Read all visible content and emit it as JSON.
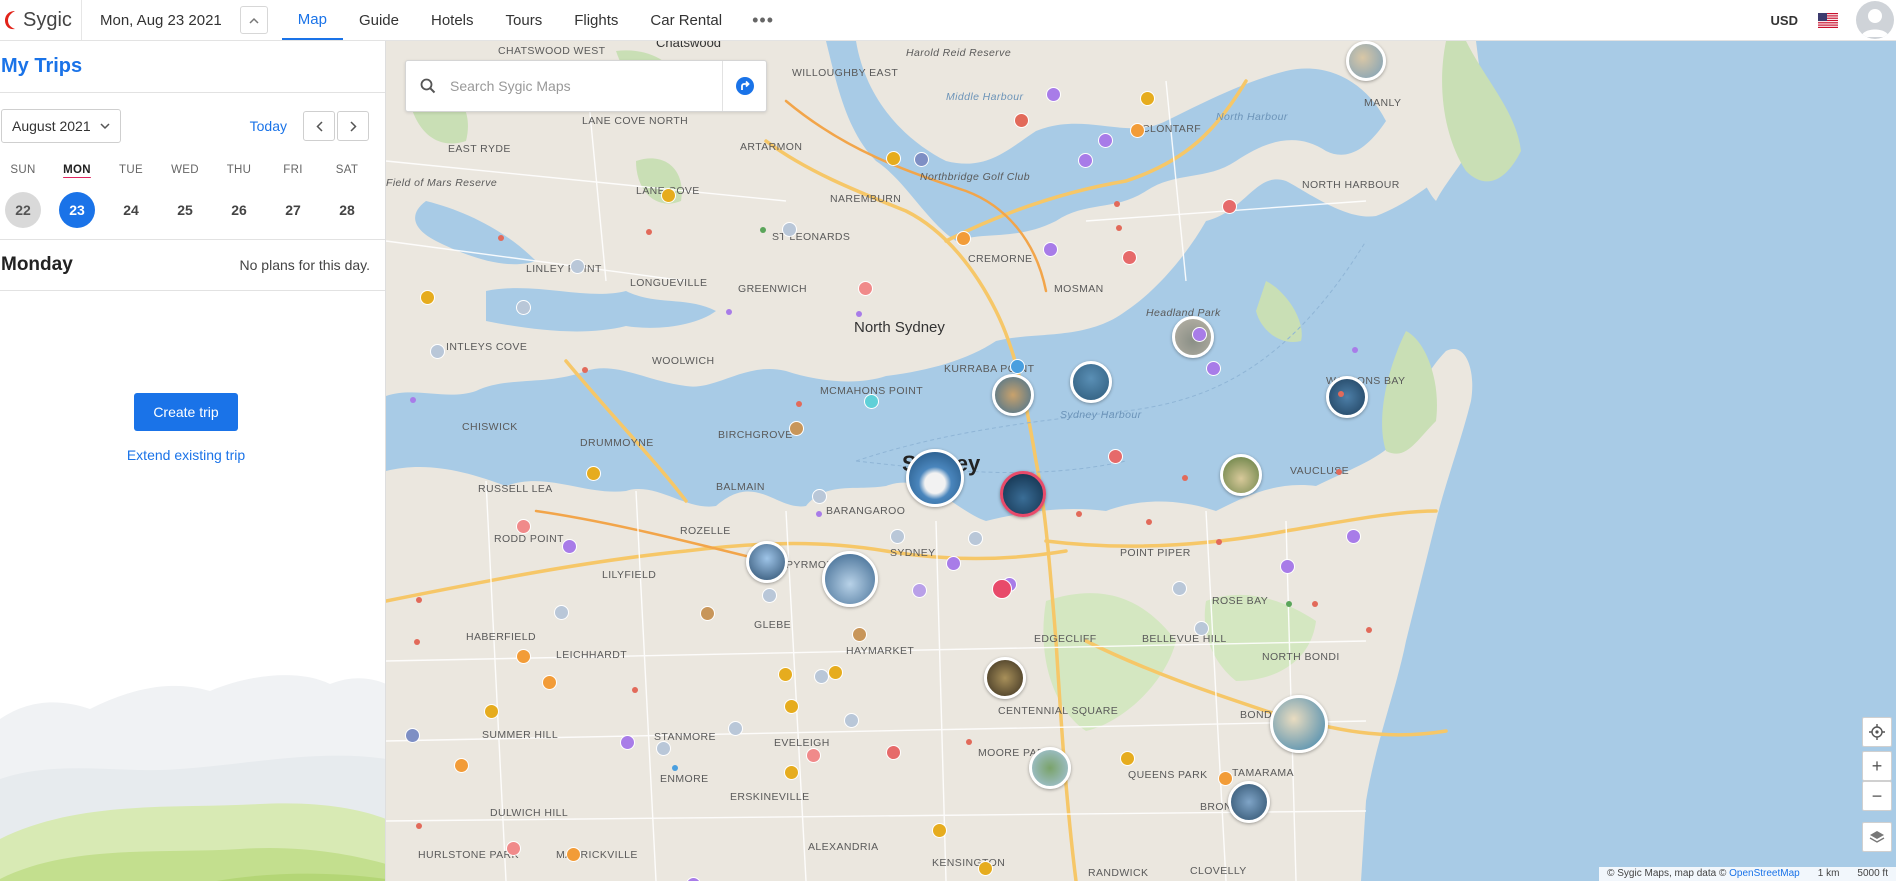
{
  "header": {
    "brand": "Sygic",
    "date": "Mon, Aug 23 2021",
    "nav": [
      {
        "label": "Map",
        "active": true
      },
      {
        "label": "Guide",
        "active": false
      },
      {
        "label": "Hotels",
        "active": false
      },
      {
        "label": "Tours",
        "active": false
      },
      {
        "label": "Flights",
        "active": false
      },
      {
        "label": "Car Rental",
        "active": false
      }
    ],
    "more": "•••",
    "currency": "USD",
    "accent_color": "#1a73e8"
  },
  "sidebar": {
    "title": "My Trips",
    "month": "August 2021",
    "today_label": "Today",
    "weekdays": [
      "SUN",
      "MON",
      "TUE",
      "WED",
      "THU",
      "FRI",
      "SAT"
    ],
    "days": [
      "22",
      "23",
      "24",
      "25",
      "26",
      "27",
      "28"
    ],
    "selected_index": 1,
    "day_name": "Monday",
    "no_plans": "No plans for this day.",
    "create_trip": "Create trip",
    "extend_trip": "Extend existing trip"
  },
  "map": {
    "search_placeholder": "Search Sygic Maps",
    "places": [
      "CHATSWOOD WEST",
      "Chatswood",
      "Harold Reid Reserve",
      "WILLOUGHBY EAST",
      "Middle Harbour",
      "MANLY",
      "CLONTARF",
      "North Harbour",
      "NORTH HARBOUR",
      "LANE COVE NORTH",
      "ARTARMON",
      "EAST RYDE",
      "Field of Mars Reserve",
      "LANE COVE",
      "Northbridge Golf Club",
      "NAREMBURN",
      "ST LEONARDS",
      "CREMORNE",
      "MOSMAN",
      "LINLEY POINT",
      "LONGUEVILLE",
      "GREENWICH",
      "North Sydney",
      "Headland Park",
      "KURRABA POINT",
      "WATSONS BAY",
      "INTLEYS COVE",
      "WOOLWICH",
      "MCMAHONS POINT",
      "Sydney Harbour",
      "CHISWICK",
      "DRUMMOYNE",
      "BIRCHGROVE",
      "Sydney",
      "VAUCLUSE",
      "RUSSELL LEA",
      "BALMAIN",
      "BARANGAROO",
      "RODD POINT",
      "ROZELLE",
      "LILYFIELD",
      "PYRMONT",
      "SYDNEY",
      "POINT PIPER",
      "ROSE BAY",
      "HABERFIELD",
      "GLEBE",
      "HAYMARKET",
      "EDGECLIFF",
      "BELLEVUE HILL",
      "NORTH BONDI",
      "LEICHHARDT",
      "CENTENNIAL SQUARE",
      "BONDI",
      "STANMORE",
      "SUMMER HILL",
      "MOORE PARK",
      "QUEENS PARK",
      "TAMARAMA",
      "ENMORE",
      "ERSKINEVILLE",
      "DULWICH HILL",
      "BRONTE",
      "HURLSTONE PARK",
      "MARRICKVILLE",
      "ALEXANDRIA",
      "KENSINGTON",
      "RANDWICK",
      "CLOVELLY",
      "EVELEIGH"
    ],
    "attribution": "© Sygic Maps, map data ©",
    "attribution_link": "OpenStreetMap",
    "scale_km": "1 km",
    "scale_ft": "5000 ft",
    "colors": {
      "water": "#a8cbe6",
      "land": "#ebe7df",
      "park": "#c9dfb5",
      "road": "#f6c768"
    }
  },
  "icons": [
    "sygic-logo-icon",
    "chevron-up-icon",
    "chevron-down-icon",
    "chevron-left-icon",
    "chevron-right-icon",
    "more-icon",
    "us-flag-icon",
    "avatar-icon",
    "search-icon",
    "directions-icon",
    "locate-icon",
    "zoom-in-icon",
    "zoom-out-icon",
    "layers-icon"
  ]
}
